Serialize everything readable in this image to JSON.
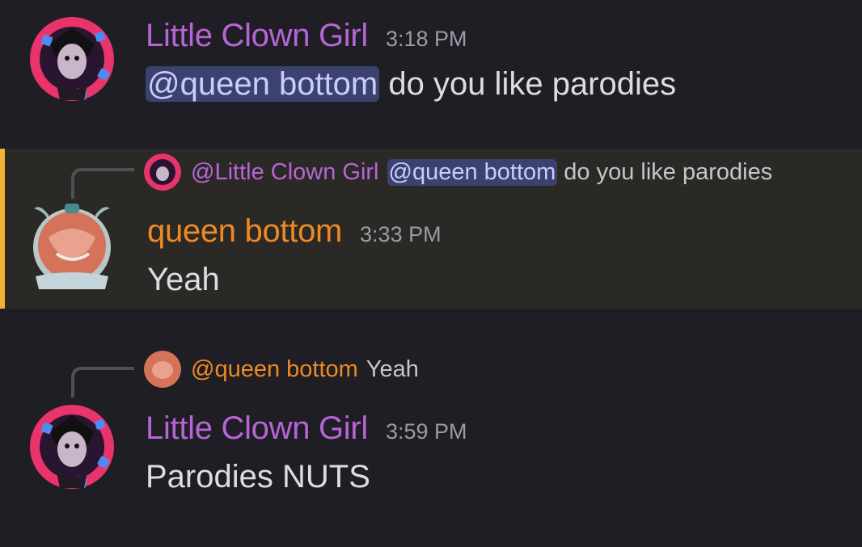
{
  "colors": {
    "clown_name": "#b765d6",
    "queen_name": "#ee8a24",
    "highlight_bar": "#f0b232"
  },
  "messages": [
    {
      "author": "Little Clown Girl",
      "timestamp": "3:18 PM",
      "mention": "@queen bottom",
      "text": " do you like parodies"
    },
    {
      "reply": {
        "author": "@Little Clown Girl",
        "mention": "@queen bottom",
        "text": "do you like parodies"
      },
      "author": "queen bottom",
      "timestamp": "3:33 PM",
      "text": "Yeah"
    },
    {
      "reply": {
        "author": "@queen bottom",
        "text": "Yeah"
      },
      "author": "Little Clown Girl",
      "timestamp": "3:59 PM",
      "text": "Parodies NUTS"
    }
  ]
}
